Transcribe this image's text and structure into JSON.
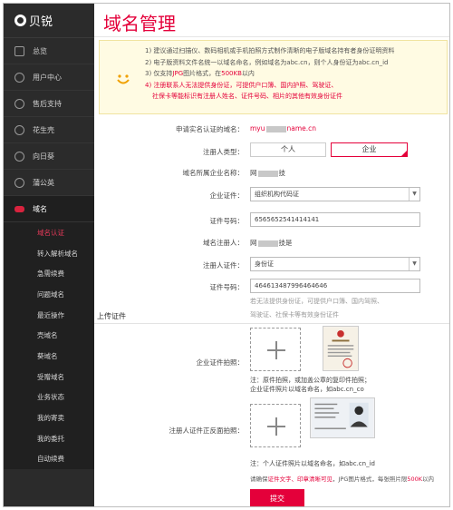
{
  "brand": {
    "name": "贝锐"
  },
  "sidebar": {
    "items": [
      {
        "label": "总览"
      },
      {
        "label": "用户中心"
      },
      {
        "label": "售后支持"
      },
      {
        "label": "花生壳"
      },
      {
        "label": "向日葵"
      },
      {
        "label": "蒲公英"
      },
      {
        "label": "域名"
      }
    ],
    "sub_items": [
      {
        "label": "域名认证"
      },
      {
        "label": "转入解析域名"
      },
      {
        "label": "急需续费"
      },
      {
        "label": "问题域名"
      },
      {
        "label": "最近操作"
      },
      {
        "label": "壳域名"
      },
      {
        "label": "葵域名"
      },
      {
        "label": "受赠域名"
      },
      {
        "label": "业务状态"
      },
      {
        "label": "我的寄卖"
      },
      {
        "label": "我的委托"
      },
      {
        "label": "自动续费"
      }
    ]
  },
  "page": {
    "title": "域名管理"
  },
  "notice": {
    "line1": "1) 建议通过扫描仪、数码相机或手机拍照方式制作清晰的电子版域名持有者身份证明资料",
    "line2": "2) 电子版资料文件名统一以域名命名，例如域名为abc.cn，则个人身份证为abc.cn_id",
    "line3a": "3) 仅支持",
    "line3b": "JPG",
    "line3c": "图片格式，在",
    "line3d": "500KB",
    "line3e": "以内",
    "line4": "4) 注册联系人无法提供身份证，可提供户口簿、国内护照、驾驶证、",
    "line5": "社保卡等能标识有注册人姓名、证件号码、相片的其他有效身份证件"
  },
  "form": {
    "domain_label": "申请实名认证的域名：",
    "domain_value_a": "myu",
    "domain_value_b": "name.cn",
    "reg_type_label": "注册人类型：",
    "reg_type_personal": "个人",
    "reg_type_company": "企业",
    "company_name_label": "域名所属企业名称：",
    "company_name_a": "网",
    "company_name_b": "技",
    "company_cert_label": "企业证件：",
    "company_cert_value": "组织机构代码证",
    "cert_no_label": "证件号码：",
    "cert_no_value": "6565652541414141",
    "registrant_label": "域名注册人：",
    "registrant_a": "网",
    "registrant_b": "技是",
    "reg_cert_label": "注册人证件：",
    "reg_cert_value": "身份证",
    "reg_cert_no_label": "证件号码：",
    "reg_cert_no_value": "464613487996464646",
    "hint_line1": "若无法提供身份证，可提供户口簿、国内驾照、",
    "hint_line2": "驾驶证、社保卡等有效身份证件"
  },
  "upload": {
    "section_title": "上传证件",
    "company_label": "企业证件拍照：",
    "company_note1": "注：原件拍照，或加盖公章的复印件拍照；",
    "company_note2": "企业证件照片以域名命名，如abc.cn_co",
    "person_label": "注册人证件正反面拍照：",
    "person_note": "注：个人证件照片以域名命名，如abc.cn_id",
    "bottom_a": "请确保",
    "bottom_b": "证件文字、印章清晰可见",
    "bottom_c": "，JPG图片格式，每张照片限",
    "bottom_d": "500K",
    "bottom_e": "以内",
    "submit_label": "提交"
  }
}
